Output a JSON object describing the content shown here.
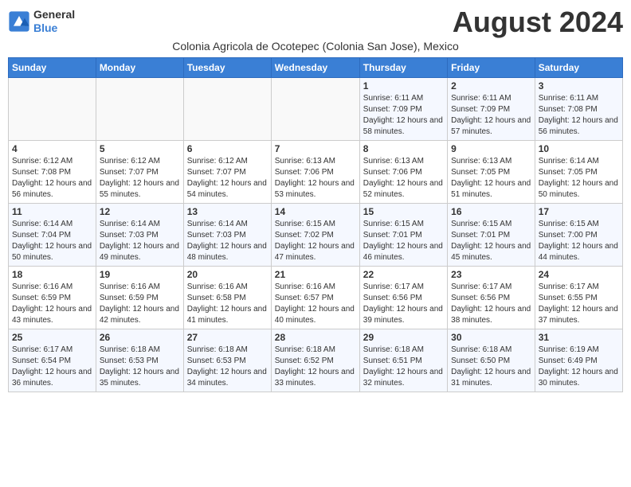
{
  "header": {
    "logo_general": "General",
    "logo_blue": "Blue",
    "month_title": "August 2024",
    "subtitle": "Colonia Agricola de Ocotepec (Colonia San Jose), Mexico"
  },
  "weekdays": [
    "Sunday",
    "Monday",
    "Tuesday",
    "Wednesday",
    "Thursday",
    "Friday",
    "Saturday"
  ],
  "weeks": [
    [
      {
        "day": "",
        "sunrise": "",
        "sunset": "",
        "daylight": ""
      },
      {
        "day": "",
        "sunrise": "",
        "sunset": "",
        "daylight": ""
      },
      {
        "day": "",
        "sunrise": "",
        "sunset": "",
        "daylight": ""
      },
      {
        "day": "",
        "sunrise": "",
        "sunset": "",
        "daylight": ""
      },
      {
        "day": "1",
        "sunrise": "6:11 AM",
        "sunset": "7:09 PM",
        "daylight": "12 hours and 58 minutes."
      },
      {
        "day": "2",
        "sunrise": "6:11 AM",
        "sunset": "7:09 PM",
        "daylight": "12 hours and 57 minutes."
      },
      {
        "day": "3",
        "sunrise": "6:11 AM",
        "sunset": "7:08 PM",
        "daylight": "12 hours and 56 minutes."
      }
    ],
    [
      {
        "day": "4",
        "sunrise": "6:12 AM",
        "sunset": "7:08 PM",
        "daylight": "12 hours and 56 minutes."
      },
      {
        "day": "5",
        "sunrise": "6:12 AM",
        "sunset": "7:07 PM",
        "daylight": "12 hours and 55 minutes."
      },
      {
        "day": "6",
        "sunrise": "6:12 AM",
        "sunset": "7:07 PM",
        "daylight": "12 hours and 54 minutes."
      },
      {
        "day": "7",
        "sunrise": "6:13 AM",
        "sunset": "7:06 PM",
        "daylight": "12 hours and 53 minutes."
      },
      {
        "day": "8",
        "sunrise": "6:13 AM",
        "sunset": "7:06 PM",
        "daylight": "12 hours and 52 minutes."
      },
      {
        "day": "9",
        "sunrise": "6:13 AM",
        "sunset": "7:05 PM",
        "daylight": "12 hours and 51 minutes."
      },
      {
        "day": "10",
        "sunrise": "6:14 AM",
        "sunset": "7:05 PM",
        "daylight": "12 hours and 50 minutes."
      }
    ],
    [
      {
        "day": "11",
        "sunrise": "6:14 AM",
        "sunset": "7:04 PM",
        "daylight": "12 hours and 50 minutes."
      },
      {
        "day": "12",
        "sunrise": "6:14 AM",
        "sunset": "7:03 PM",
        "daylight": "12 hours and 49 minutes."
      },
      {
        "day": "13",
        "sunrise": "6:14 AM",
        "sunset": "7:03 PM",
        "daylight": "12 hours and 48 minutes."
      },
      {
        "day": "14",
        "sunrise": "6:15 AM",
        "sunset": "7:02 PM",
        "daylight": "12 hours and 47 minutes."
      },
      {
        "day": "15",
        "sunrise": "6:15 AM",
        "sunset": "7:01 PM",
        "daylight": "12 hours and 46 minutes."
      },
      {
        "day": "16",
        "sunrise": "6:15 AM",
        "sunset": "7:01 PM",
        "daylight": "12 hours and 45 minutes."
      },
      {
        "day": "17",
        "sunrise": "6:15 AM",
        "sunset": "7:00 PM",
        "daylight": "12 hours and 44 minutes."
      }
    ],
    [
      {
        "day": "18",
        "sunrise": "6:16 AM",
        "sunset": "6:59 PM",
        "daylight": "12 hours and 43 minutes."
      },
      {
        "day": "19",
        "sunrise": "6:16 AM",
        "sunset": "6:59 PM",
        "daylight": "12 hours and 42 minutes."
      },
      {
        "day": "20",
        "sunrise": "6:16 AM",
        "sunset": "6:58 PM",
        "daylight": "12 hours and 41 minutes."
      },
      {
        "day": "21",
        "sunrise": "6:16 AM",
        "sunset": "6:57 PM",
        "daylight": "12 hours and 40 minutes."
      },
      {
        "day": "22",
        "sunrise": "6:17 AM",
        "sunset": "6:56 PM",
        "daylight": "12 hours and 39 minutes."
      },
      {
        "day": "23",
        "sunrise": "6:17 AM",
        "sunset": "6:56 PM",
        "daylight": "12 hours and 38 minutes."
      },
      {
        "day": "24",
        "sunrise": "6:17 AM",
        "sunset": "6:55 PM",
        "daylight": "12 hours and 37 minutes."
      }
    ],
    [
      {
        "day": "25",
        "sunrise": "6:17 AM",
        "sunset": "6:54 PM",
        "daylight": "12 hours and 36 minutes."
      },
      {
        "day": "26",
        "sunrise": "6:18 AM",
        "sunset": "6:53 PM",
        "daylight": "12 hours and 35 minutes."
      },
      {
        "day": "27",
        "sunrise": "6:18 AM",
        "sunset": "6:53 PM",
        "daylight": "12 hours and 34 minutes."
      },
      {
        "day": "28",
        "sunrise": "6:18 AM",
        "sunset": "6:52 PM",
        "daylight": "12 hours and 33 minutes."
      },
      {
        "day": "29",
        "sunrise": "6:18 AM",
        "sunset": "6:51 PM",
        "daylight": "12 hours and 32 minutes."
      },
      {
        "day": "30",
        "sunrise": "6:18 AM",
        "sunset": "6:50 PM",
        "daylight": "12 hours and 31 minutes."
      },
      {
        "day": "31",
        "sunrise": "6:19 AM",
        "sunset": "6:49 PM",
        "daylight": "12 hours and 30 minutes."
      }
    ]
  ]
}
